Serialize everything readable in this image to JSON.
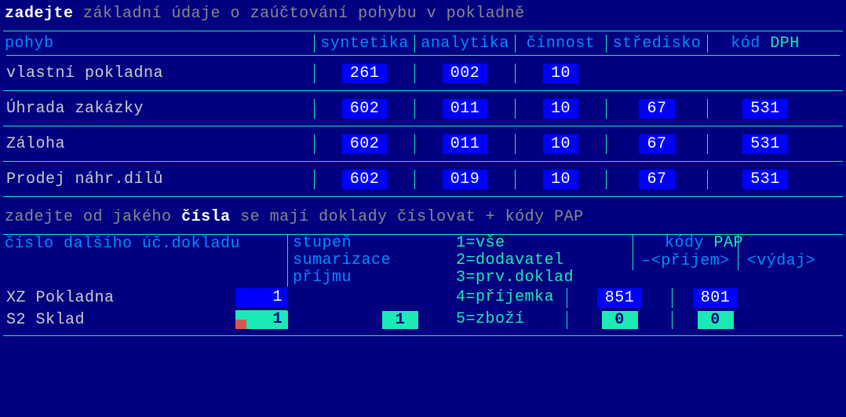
{
  "prompt1": {
    "hl": "zadejte",
    "rest": "základní údaje o zaúčtování pohybu v pokladně"
  },
  "table1": {
    "headers": {
      "name": "pohyb",
      "c1": "syntetika",
      "c2": "analytika",
      "c3": "čínnost",
      "c4": "středisko",
      "c5a": "kód",
      "c5b": "DPH"
    },
    "rows": [
      {
        "name": "vlastní pokladna",
        "c1": "261",
        "c2": "002",
        "c3": "10",
        "c4": "",
        "c5": ""
      },
      {
        "name": "Úhrada zakázky",
        "c1": "602",
        "c2": "011",
        "c3": "10",
        "c4": "67",
        "c5": "531"
      },
      {
        "name": "Záloha",
        "c1": "602",
        "c2": "011",
        "c3": "10",
        "c4": "67",
        "c5": "531"
      },
      {
        "name": "Prodej náhr.dílů",
        "c1": "602",
        "c2": "019",
        "c3": "10",
        "c4": "67",
        "c5": "531"
      }
    ]
  },
  "prompt2": {
    "pre": "zadejte od jakého",
    "hl": "čísla",
    "post": "se mají doklady číslovat + kódy PAP"
  },
  "section2": {
    "headers": {
      "a": "číslo dalšího úč.dokladu",
      "b1": "stupeň",
      "b2": "sumarizace",
      "b3": "příjmu",
      "c1": "1=vše",
      "c2": "2=dodavatel",
      "c3": "3=prv.doklad",
      "c4": "4=příjemka",
      "c5": "5=zboží",
      "kody": "kódy",
      "pap": "PAP",
      "d": "–<příjem>",
      "e": "<výdaj>"
    },
    "rows": [
      {
        "name": "XZ Pokladna",
        "val": "1",
        "active": false,
        "sum": "",
        "d": "851",
        "e": "801"
      },
      {
        "name": "S2 Sklad",
        "val": "1",
        "active": true,
        "sum": "1",
        "d": "0",
        "e": "0"
      }
    ]
  }
}
